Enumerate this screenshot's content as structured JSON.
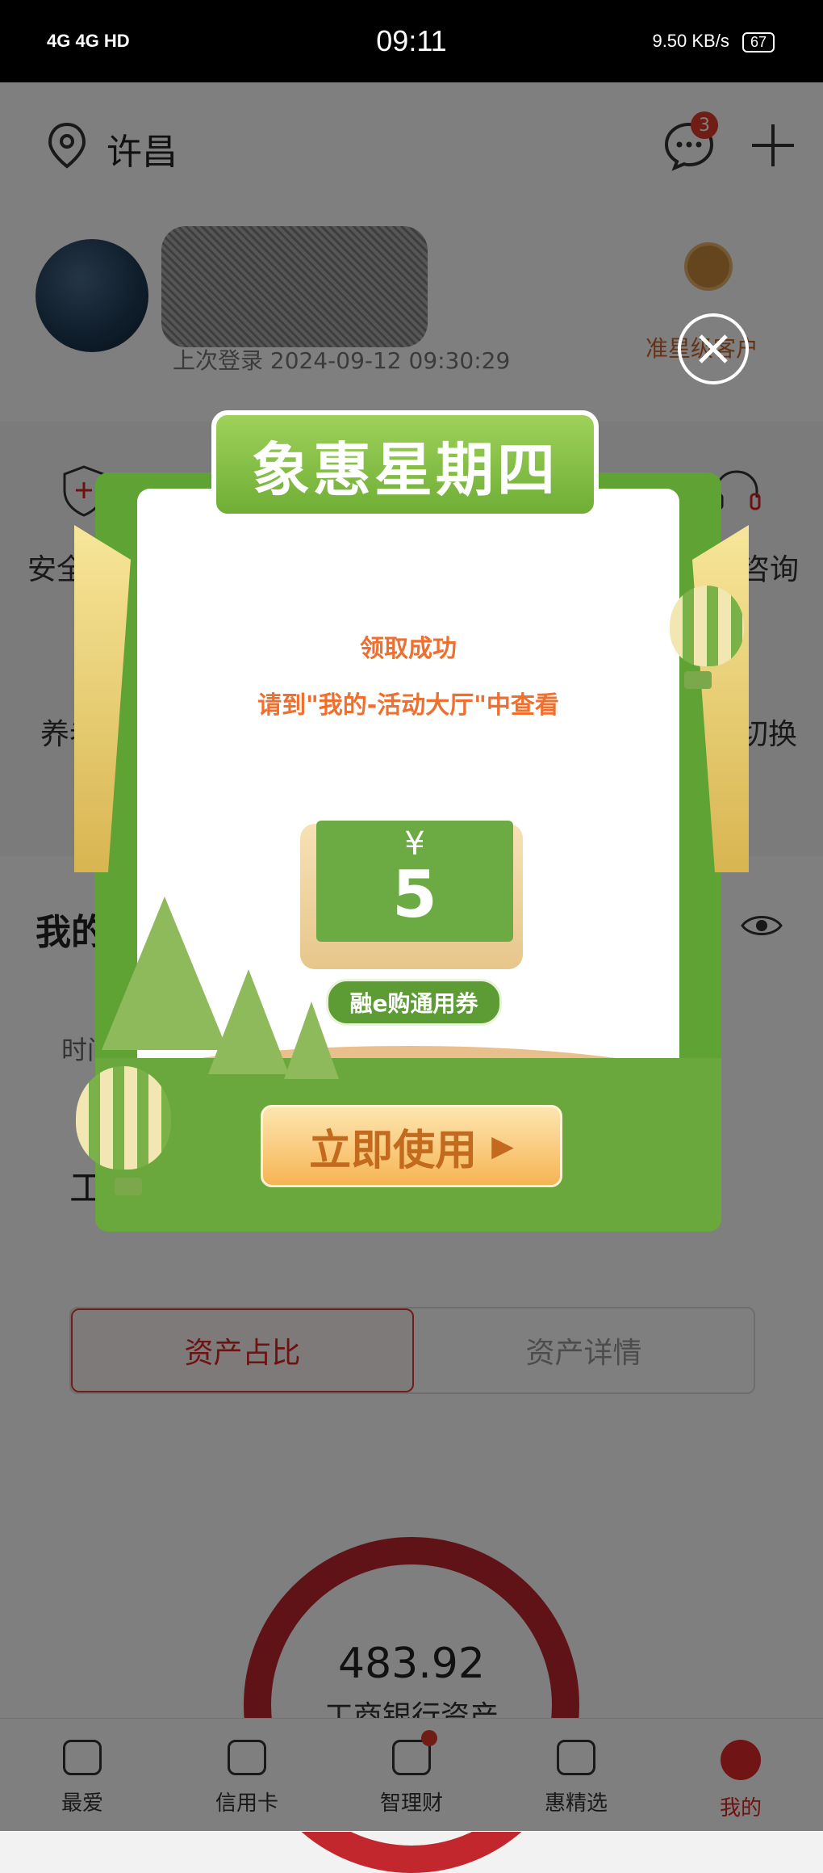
{
  "status_bar": {
    "time": "09:11",
    "network_left": "4G 4G HD",
    "speed": "9.50 KB/s",
    "battery": "67"
  },
  "header": {
    "location": "许昌",
    "message_count": "3",
    "login_info": "上次登录 2024-09-12 09:30:29",
    "vip_label": "准星级客户"
  },
  "quick_grid": {
    "items": [
      "安全",
      "咨询",
      "养老",
      "本切换"
    ]
  },
  "section": {
    "title": "我的",
    "row_label": "时间",
    "bank_prefix": "工",
    "tabs": [
      "资产占比",
      "资产详情"
    ],
    "donut_value": "483.92",
    "donut_label": "工商银行资产"
  },
  "bottom_nav": {
    "items": [
      "最爱",
      "信用卡",
      "智理财",
      "惠精选",
      "我的"
    ]
  },
  "modal": {
    "title": "象惠星期四",
    "success": "领取成功",
    "hint": "请到\"我的-活动大厅\"中查看",
    "coupon_currency": "¥",
    "coupon_amount": "5",
    "coupon_label": "融e购通用券",
    "action": "立即使用"
  },
  "colors": {
    "accent_red": "#d22",
    "modal_green": "#6aa83d",
    "modal_orange": "#ef6f2f"
  }
}
